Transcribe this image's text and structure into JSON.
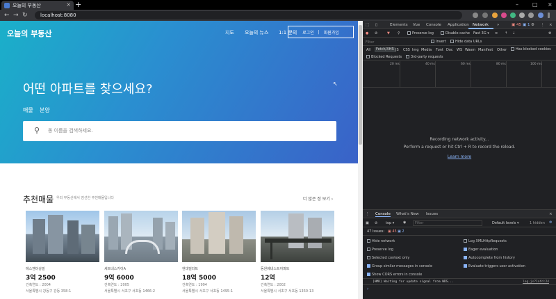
{
  "browser": {
    "tab_title": "오늘의 부동산",
    "tab_close": "×",
    "new_tab": "+",
    "url": "localhost:8080",
    "window_controls": {
      "minimize": "–",
      "maximize": "□",
      "close": "×"
    }
  },
  "site": {
    "logo": "오늘의 부동산",
    "nav": [
      "지도",
      "오늘의 뉴스",
      "1:1 문의"
    ],
    "login": "로그인",
    "divider": "|",
    "signup": "회원가입",
    "hero_title": "어떤 아파트를 찾으세요?",
    "hero_tabs": [
      "매물",
      "분양"
    ],
    "search_placeholder": "동 이름을 검색하세요.",
    "rec_title": "추천매물",
    "rec_subtitle": "우리 부동산에서 엄선한 추천매물입니다",
    "rec_more": "더 많은 정 보기",
    "listings": [
      {
        "type": "에스엠이상빌",
        "price": "3억 2500",
        "year": "건축연도 : 2004",
        "address": "서울특별시 강동구 강동 358-1"
      },
      {
        "type": "세트네스카이A",
        "price": "9억 6000",
        "year": "건축연도 : 2005",
        "address": "서울특별시 서초구 서초동 1466-2"
      },
      {
        "type": "현대빌라트",
        "price": "18억 5000",
        "year": "건축연도 : 1994",
        "address": "서울특별시 서초구 서초동 1495-1"
      },
      {
        "type": "동원베네스트아파트",
        "price": "12억",
        "year": "건축연도 : 2002",
        "address": "서울특별시 서초구 서초동 1350-13"
      }
    ]
  },
  "devtools": {
    "tabs": [
      "Elements",
      "Vue",
      "Console",
      "Application",
      "Network"
    ],
    "more": "»",
    "errors": "45",
    "warnings": "1",
    "preserve_log": "Preserve log",
    "disable_cache": "Disable cache",
    "throttle": "Fast 3G",
    "filter_placeholder": "Filter",
    "invert": "Invert",
    "hide_data_urls": "Hide data URLs",
    "types": [
      "All",
      "Fetch/XHR",
      "JS",
      "CSS",
      "Img",
      "Media",
      "Font",
      "Doc",
      "WS",
      "Wasm",
      "Manifest",
      "Other"
    ],
    "blocked_cookies": "Has blocked cookies",
    "blocked_requests": "Blocked Requests",
    "third_party": "3rd-party requests",
    "ticks": [
      "20 ms",
      "40 ms",
      "60 ms",
      "80 ms",
      "100 ms"
    ],
    "recording": "Recording network activity...",
    "perform": "Perform a request or hit Ctrl + R to record the reload.",
    "learn_more": "Learn more",
    "drawer_tabs": [
      "Console",
      "What's New",
      "Issues"
    ],
    "context": "top",
    "console_filter": "Filter",
    "default_levels": "Default levels",
    "hidden": "1 hidden",
    "issues_label": "47 Issues:",
    "issues_errors": "45",
    "issues_info": "2",
    "settings_left": [
      "Hide network",
      "Preserve log",
      "Selected context only",
      "Group similar messages in console",
      "Show CORS errors in console"
    ],
    "settings_right": [
      "Log XMLHttpRequests",
      "Eager evaluation",
      "Autocomplete from history",
      "Evaluate triggers user activation"
    ],
    "settings_left_checked": [
      false,
      false,
      false,
      true,
      true
    ],
    "settings_right_checked": [
      false,
      true,
      true,
      true
    ],
    "hmr_msg": "[HMR] Waiting for update signal from WDS...",
    "hmr_src": "log.js?1afd:24",
    "prompt": "›"
  },
  "colors": {
    "accent": "#8ab4f8",
    "hero_start": "#1ab0c9",
    "hero_end": "#3a62c8",
    "error": "#f28b82"
  }
}
